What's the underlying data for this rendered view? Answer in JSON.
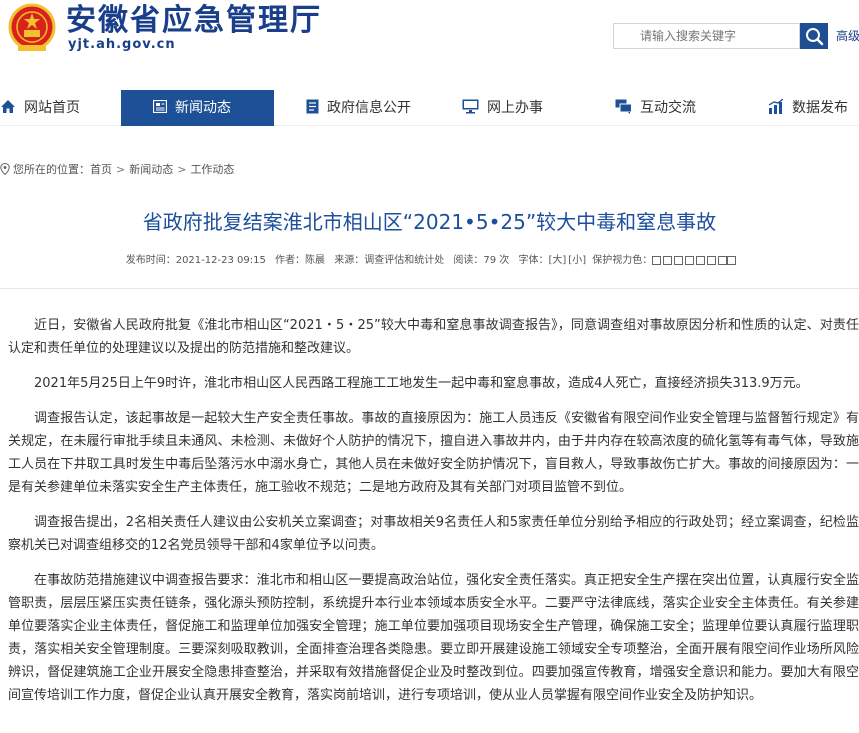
{
  "header": {
    "site_title": "安徽省应急管理厅",
    "site_domain": "yjt.ah.gov.cn",
    "search_placeholder": "请输入搜索关键字",
    "advanced_link": "高级"
  },
  "nav": {
    "items": [
      {
        "label": "网站首页",
        "icon": "home-icon",
        "active": false
      },
      {
        "label": "新闻动态",
        "icon": "news-icon",
        "active": true
      },
      {
        "label": "政府信息公开",
        "icon": "document-icon",
        "active": false
      },
      {
        "label": "网上办事",
        "icon": "monitor-icon",
        "active": false
      },
      {
        "label": "互动交流",
        "icon": "chat-icon",
        "active": false
      },
      {
        "label": "数据发布",
        "icon": "chart-icon",
        "active": false
      }
    ]
  },
  "breadcrumb": {
    "prefix": "您所在的位置：",
    "items": [
      "首页",
      "新闻动态",
      "工作动态"
    ],
    "separator": ">"
  },
  "article": {
    "title": "省政府批复结案淮北市相山区“2021•5•25”较大中毒和窒息事故",
    "meta": {
      "date": "发布时间：2021-12-23 09:15",
      "author": "作者：陈晨",
      "source": "来源：调查评估和统计处",
      "views": "阅读：79 次",
      "font_label": "字体：",
      "font_large": "[大]",
      "font_small": "[小]",
      "protect": "保护视力色："
    },
    "paragraphs": [
      "近日，安徽省人民政府批复《淮北市相山区“2021・5・25”较大中毒和窒息事故调查报告》，同意调查组对事故原因分析和性质的认定、对责任认定和责任单位的处理建议以及提出的防范措施和整改建议。",
      "2021年5月25日上午9时许，淮北市相山区人民西路工程施工工地发生一起中毒和窒息事故，造成4人死亡，直接经济损失313.9万元。",
      "调查报告认定，该起事故是一起较大生产安全责任事故。事故的直接原因为：施工人员违反《安徽省有限空间作业安全管理与监督暂行规定》有关规定，在未履行审批手续且未通风、未检测、未做好个人防护的情况下，擅自进入事故井内，由于井内存在较高浓度的硫化氢等有毒气体，导致施工人员在下井取工具时发生中毒后坠落污水中溺水身亡，其他人员在未做好安全防护情况下，盲目救人，导致事故伤亡扩大。事故的间接原因为：一是有关参建单位未落实安全生产主体责任，施工验收不规范；二是地方政府及其有关部门对项目监管不到位。",
      "调查报告提出，2名相关责任人建议由公安机关立案调查；对事故相关9名责任人和5家责任单位分别给予相应的行政处罚；经立案调查，纪检监察机关已对调查组移交的12名党员领导干部和4家单位予以问责。",
      "在事故防范措施建议中调查报告要求：淮北市和相山区一要提高政治站位，强化安全责任落实。真正把安全生产摆在突出位置，认真履行安全监管职责，层层压紧压实责任链条，强化源头预防控制，系统提升本行业本领域本质安全水平。二要严守法律底线，落实企业安全主体责任。有关参建单位要落实企业主体责任，督促施工和监理单位加强安全管理；施工单位要加强项目现场安全生产管理，确保施工安全；监理单位要认真履行监理职责，落实相关安全管理制度。三要深刻吸取教训，全面排查治理各类隐患。要立即开展建设施工领域安全专项整治，全面开展有限空间作业场所风险辨识，督促建筑施工企业开展安全隐患排查整治，并采取有效措施督促企业及时整改到位。四要加强宣传教育，增强安全意识和能力。要加大有限空间宣传培训工作力度，督促企业认真开展安全教育，落实岗前培训，进行专项培训，使从业人员掌握有限空间作业安全及防护知识。"
    ]
  },
  "colors": {
    "brand_blue": "#1a3f8a",
    "nav_active": "#1d5096",
    "title_blue": "#1d4f9c",
    "emblem_red": "#d9221c",
    "emblem_gold": "#f2c12e"
  }
}
